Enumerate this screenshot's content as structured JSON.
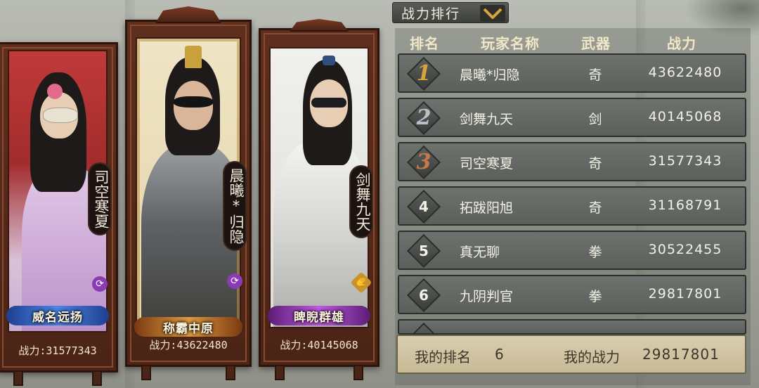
{
  "showcase": [
    {
      "name": "司空寒夏",
      "title": "威名远扬",
      "power_label": "战力:31577343",
      "badge_icon": "swirl-icon",
      "bg": "#b93a3a",
      "banner_color": "#3b6fd1"
    },
    {
      "name": "晨曦*归隐",
      "title": "称霸中原",
      "power_label": "战力:43622480",
      "badge_icon": "swirl-icon",
      "bg": "#e4d8b4",
      "banner_color": "#c8762a"
    },
    {
      "name": "剑舞九天",
      "title": "睥睨群雄",
      "power_label": "战力:40145068",
      "badge_icon": "glove-icon",
      "bg": "#e6e6e2",
      "banner_color": "#a43fc4"
    }
  ],
  "ranking": {
    "tab_label": "战力排行",
    "headers": {
      "rank": "排名",
      "player": "玩家名称",
      "weapon": "武器",
      "power": "战力"
    },
    "rows": [
      {
        "rank": "1",
        "player": "晨曦*归隐",
        "weapon": "奇",
        "power": "43622480"
      },
      {
        "rank": "2",
        "player": "剑舞九天",
        "weapon": "剑",
        "power": "40145068"
      },
      {
        "rank": "3",
        "player": "司空寒夏",
        "weapon": "奇",
        "power": "31577343"
      },
      {
        "rank": "4",
        "player": "拓跋阳旭",
        "weapon": "奇",
        "power": "31168791"
      },
      {
        "rank": "5",
        "player": "真无聊",
        "weapon": "拳",
        "power": "30522455"
      },
      {
        "rank": "6",
        "player": "九阴判官",
        "weapon": "拳",
        "power": "29817801"
      }
    ],
    "my_rank_label": "我的排名",
    "my_rank_value": "6",
    "my_power_label": "我的战力",
    "my_power_value": "29817801"
  },
  "colors": {
    "gold": "#d9a53a",
    "silver": "#b9c0c8",
    "bronze": "#c7774a"
  }
}
